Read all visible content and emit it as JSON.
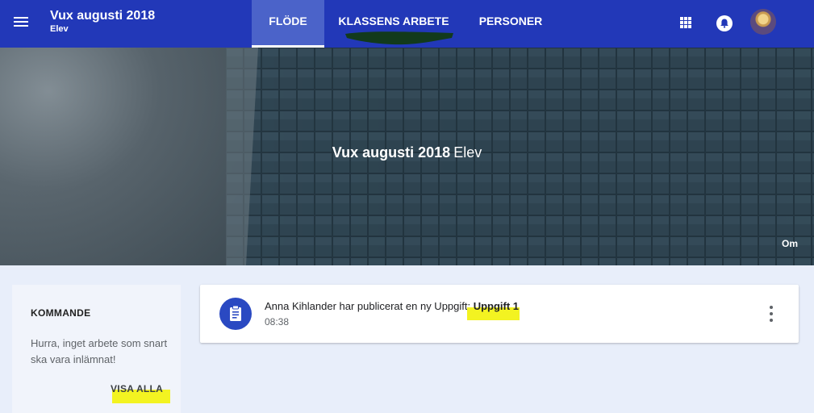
{
  "header": {
    "class_title": "Vux augusti 2018",
    "class_subtitle": "Elev",
    "tabs": [
      {
        "label": "FLÖDE",
        "active": true
      },
      {
        "label": "KLASSENS ARBETE",
        "active": false
      },
      {
        "label": "PERSONER",
        "active": false
      }
    ]
  },
  "banner": {
    "title": "Vux augusti 2018",
    "subtitle": "Elev",
    "about_label": "Om"
  },
  "upcoming": {
    "title": "KOMMANDE",
    "message": "Hurra, inget arbete som snart ska vara inlämnat!",
    "view_all_label": "VISA ALLA"
  },
  "stream": {
    "posts": [
      {
        "text_prefix": "Anna Kihlander har publicerat en ny Uppgift: ",
        "link_text": "Uppgift 1",
        "time": "08:38"
      }
    ]
  },
  "colors": {
    "appbar": "#2238b8",
    "active_tab": "#4b63c9",
    "page_bg": "#e8eefa",
    "highlight": "#f3f321",
    "post_icon": "#2a49c2"
  }
}
